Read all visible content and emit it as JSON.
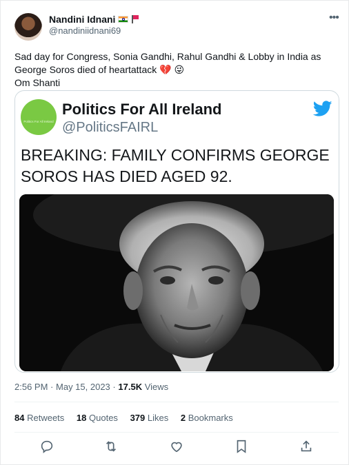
{
  "author": {
    "name": "Nandini Idnani",
    "handle": "@nandiniidnani69",
    "badges": [
      "india-flag-emoji",
      "red-flag-emoji"
    ]
  },
  "tweet": {
    "lines": [
      "Sad day for Congress, Sonia Gandhi, Rahul Gandhi & Lobby in India as",
      "George Soros died of heartattack 💔 😜",
      "Om Shanti"
    ]
  },
  "card": {
    "account_name": "Politics For All Ireland",
    "account_handle": "@PoliticsFAIRL",
    "logo_text": "Politics For All Ireland",
    "headline_lines": [
      "BREAKING: FAMILY CONFIRMS GEORGE",
      "SOROS HAS DIED AGED 92."
    ],
    "logo_color": "#7ac943",
    "bird_color": "#1da1f2"
  },
  "meta": {
    "time": "2:56 PM",
    "separator": "·",
    "date": "May 15, 2023",
    "views_count": "17.5K",
    "views_label": "Views"
  },
  "stats": {
    "retweets_count": "84",
    "retweets_label": "Retweets",
    "quotes_count": "18",
    "quotes_label": "Quotes",
    "likes_count": "379",
    "likes_label": "Likes",
    "bookmarks_count": "2",
    "bookmarks_label": "Bookmarks"
  },
  "actions": [
    "reply-icon",
    "retweet-icon",
    "like-icon",
    "bookmark-icon",
    "share-icon"
  ],
  "colors": {
    "text": "#0f1419",
    "muted": "#536471",
    "border": "#cfd9de"
  }
}
